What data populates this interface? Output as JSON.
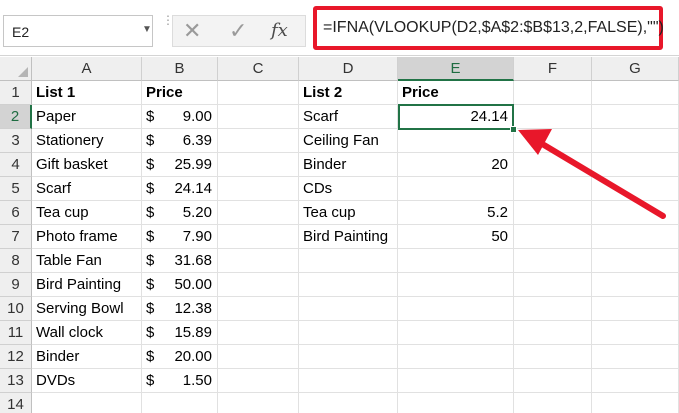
{
  "formula_bar": {
    "name_box": "E2",
    "fx_label": "fx",
    "formula": "=IFNA(VLOOKUP(D2,$A$2:$B$13,2,FALSE),\"\")"
  },
  "columns": [
    "A",
    "B",
    "C",
    "D",
    "E",
    "F",
    "G"
  ],
  "rows": [
    "1",
    "2",
    "3",
    "4",
    "5",
    "6",
    "7",
    "8",
    "9",
    "10",
    "11",
    "12",
    "13",
    "14"
  ],
  "list1": {
    "header_name": "List 1",
    "header_price": "Price",
    "currency": "$",
    "items": [
      {
        "name": "Paper",
        "price": "9.00"
      },
      {
        "name": "Stationery",
        "price": "6.39"
      },
      {
        "name": "Gift basket",
        "price": "25.99"
      },
      {
        "name": "Scarf",
        "price": "24.14"
      },
      {
        "name": "Tea cup",
        "price": "5.20"
      },
      {
        "name": "Photo frame",
        "price": "7.90"
      },
      {
        "name": "Table Fan",
        "price": "31.68"
      },
      {
        "name": "Bird Painting",
        "price": "50.00"
      },
      {
        "name": "Serving Bowl",
        "price": "12.38"
      },
      {
        "name": "Wall clock",
        "price": "15.89"
      },
      {
        "name": "Binder",
        "price": "20.00"
      },
      {
        "name": "DVDs",
        "price": "1.50"
      }
    ]
  },
  "list2": {
    "header_name": "List 2",
    "header_price": "Price",
    "items": [
      {
        "name": "Scarf",
        "price": "24.14"
      },
      {
        "name": "Ceiling Fan",
        "price": ""
      },
      {
        "name": "Binder",
        "price": "20"
      },
      {
        "name": "CDs",
        "price": ""
      },
      {
        "name": "Tea cup",
        "price": "5.2"
      },
      {
        "name": "Bird Painting",
        "price": "50"
      }
    ]
  },
  "active_cell": {
    "column": "E",
    "row": "2"
  },
  "colors": {
    "highlight": "#e8172a",
    "excel_green": "#217346"
  }
}
